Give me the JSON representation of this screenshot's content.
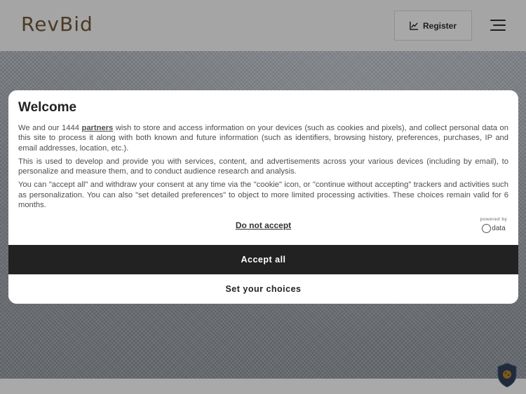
{
  "header": {
    "logo": "RevBid",
    "register_label": "Register",
    "register_icon": "chart-line-icon",
    "menu_icon": "hamburger-menu-icon"
  },
  "consent": {
    "title": "Welcome",
    "p1_before": "We and our 1444 ",
    "p1_link": "partners",
    "p1_after": " wish to store and access information on your devices (such as cookies and pixels), and collect personal data on this site to process it along with both known and future information (such as identifiers, browsing history, preferences, purchases, IP and email addresses, location, etc.).",
    "p2": "This is used to develop and provide you with services, content, and advertisements across your various devices (including by email), to personalize and measure them, and to conduct audience research and analysis.",
    "p3": "You can \"accept all\" and withdraw your consent at any time via the \"cookie\" icon, or \"continue without accepting\" trackers and activities such as personalization. You can also \"set detailed preferences\" to object to more limited processing activities. These choices remain valid for 6 months.",
    "decline_label": "Do not accept",
    "powered_by": "powered by",
    "powered_brand": "data",
    "accept_label": "Accept all",
    "choices_label": "Set your choices"
  },
  "widgets": {
    "privacy_icon": "shield-cookie-icon"
  },
  "colors": {
    "accent_dark": "#222222",
    "logo": "#4a3a25"
  }
}
